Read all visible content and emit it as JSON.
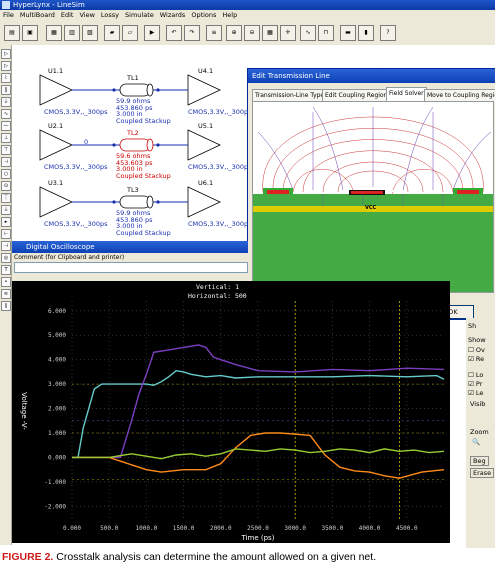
{
  "app": {
    "title": "HyperLynx - LineSim"
  },
  "menu": [
    "File",
    "MultiBoard",
    "Edit",
    "View",
    "Lossy",
    "Simulate",
    "Wizards",
    "Options",
    "Help"
  ],
  "schematic": {
    "buffers_left": [
      {
        "ref": "U1.1",
        "model": "CMOS,3.3V,,_300ps"
      },
      {
        "ref": "U2.1",
        "model": "CMOS,3.3V,,_300ps"
      },
      {
        "ref": "U3.1",
        "model": "CMOS,3.3V,,_300ps"
      }
    ],
    "buffers_right": [
      {
        "ref": "U4.1",
        "model": "CMOS,3.3V,,_300ps"
      },
      {
        "ref": "U5.1",
        "model": "CMOS,3.3V,,_300ps"
      },
      {
        "ref": "U6.1",
        "model": "CMOS,3.3V,,_300ps"
      }
    ],
    "lines": [
      {
        "ref": "TL1",
        "params": [
          "59.9 ohms",
          "453.860 ps",
          "3.000 in",
          "Coupled Stackup"
        ]
      },
      {
        "ref": "TL2",
        "params": [
          "59.6 ohms",
          "453.603 ps",
          "3.000 in",
          "Coupled Stackup"
        ]
      },
      {
        "ref": "TL3",
        "params": [
          "59.9 ohms",
          "453.860 ps",
          "3.000 in",
          "Coupled Stackup"
        ]
      }
    ],
    "node_label": "0"
  },
  "dialog": {
    "title": "Edit Transmission Line",
    "tabs": [
      "Transmission-Line Type",
      "Edit Coupling Regions",
      "Field Solver",
      "Move to Coupling Region"
    ],
    "active_tab": "Field Solver",
    "plane_label": "VCC",
    "ok_label": "OK"
  },
  "oscilloscope": {
    "title": "Digital Oscilloscope",
    "comment_label": "Comment (for Clipboard and printer)",
    "vertical_label": "Vertical: 1",
    "horizontal_label": "Horizontal: 500",
    "right_panel": {
      "items": [
        "Sh",
        "Show",
        "Ov",
        "Re",
        "Lo",
        "Pr",
        "Le",
        "Visib",
        "Zoom",
        "Beg",
        "Erase"
      ]
    }
  },
  "chart_data": {
    "type": "line",
    "xlabel": "Time (ps)",
    "ylabel": "Voltage -V-",
    "x_ticks": [
      "0.000",
      "500.0",
      "1000.0",
      "1500.0",
      "2000.0",
      "2500.0",
      "3000.0",
      "3500.0",
      "4000.0",
      "4500.0"
    ],
    "y_ticks": [
      "6.000",
      "5.000",
      "4.000",
      "3.000",
      "2.000",
      "1.000",
      "0.000",
      "-1.000",
      "-2.000"
    ],
    "xlim": [
      0,
      5000
    ],
    "ylim": [
      -2.6,
      6.4
    ],
    "grid": true,
    "series": [
      {
        "color": "#66cccc",
        "x": [
          0,
          80,
          150,
          300,
          400,
          500,
          600,
          800,
          1000,
          1100,
          1200,
          1300,
          1400,
          1500,
          1600,
          1800,
          2000,
          2200,
          2500,
          3000,
          3500,
          4000,
          4500,
          4900,
          5000
        ],
        "y": [
          0.0,
          0.0,
          1.2,
          2.8,
          3.0,
          3.0,
          3.0,
          3.0,
          3.0,
          2.95,
          3.1,
          3.3,
          3.55,
          3.5,
          3.4,
          3.3,
          3.35,
          3.25,
          3.3,
          3.3,
          3.3,
          3.35,
          3.3,
          3.35,
          3.2
        ]
      },
      {
        "color": "#7b3fc0",
        "x": [
          0,
          500,
          650,
          800,
          900,
          1000,
          1100,
          1300,
          1500,
          1700,
          1800,
          1900,
          2000,
          2200,
          2500,
          3000,
          3500,
          4000,
          4500,
          5000
        ],
        "y": [
          0.0,
          0.0,
          0.0,
          1.5,
          2.6,
          3.4,
          4.3,
          4.4,
          4.5,
          4.6,
          4.5,
          4.1,
          4.0,
          3.8,
          3.55,
          3.5,
          3.6,
          3.55,
          3.65,
          3.6
        ]
      },
      {
        "color": "#ff8c1a",
        "x": [
          0,
          500,
          800,
          1000,
          1200,
          1500,
          1800,
          2000,
          2200,
          2400,
          2600,
          2800,
          3000,
          3200,
          3400,
          3600,
          3800,
          4000,
          4200,
          4400,
          4700,
          5000
        ],
        "y": [
          0.0,
          0.0,
          -0.3,
          -0.5,
          -0.6,
          -0.5,
          -0.5,
          -0.25,
          0.4,
          0.9,
          1.0,
          1.0,
          0.95,
          0.9,
          0.1,
          -0.4,
          -0.55,
          -0.6,
          -0.75,
          -0.85,
          -0.6,
          -0.5
        ]
      },
      {
        "color": "#99cc33",
        "x": [
          0,
          500,
          800,
          1000,
          1200,
          1400,
          1600,
          1800,
          2000,
          2200,
          2400,
          2600,
          2800,
          3000,
          3200,
          3400,
          3600,
          3800,
          4000,
          4200,
          4400,
          4600,
          4800,
          5000
        ],
        "y": [
          0.0,
          0.0,
          0.15,
          0.05,
          -0.05,
          0.1,
          0.15,
          0.05,
          0.15,
          0.35,
          0.3,
          0.25,
          0.35,
          0.3,
          0.2,
          0.25,
          0.35,
          0.3,
          0.2,
          0.35,
          0.25,
          0.3,
          0.2,
          0.25
        ]
      }
    ]
  },
  "caption": {
    "figure": "FIGURE 2.",
    "text": " Crosstalk analysis can determine the amount allowed on a given net."
  }
}
